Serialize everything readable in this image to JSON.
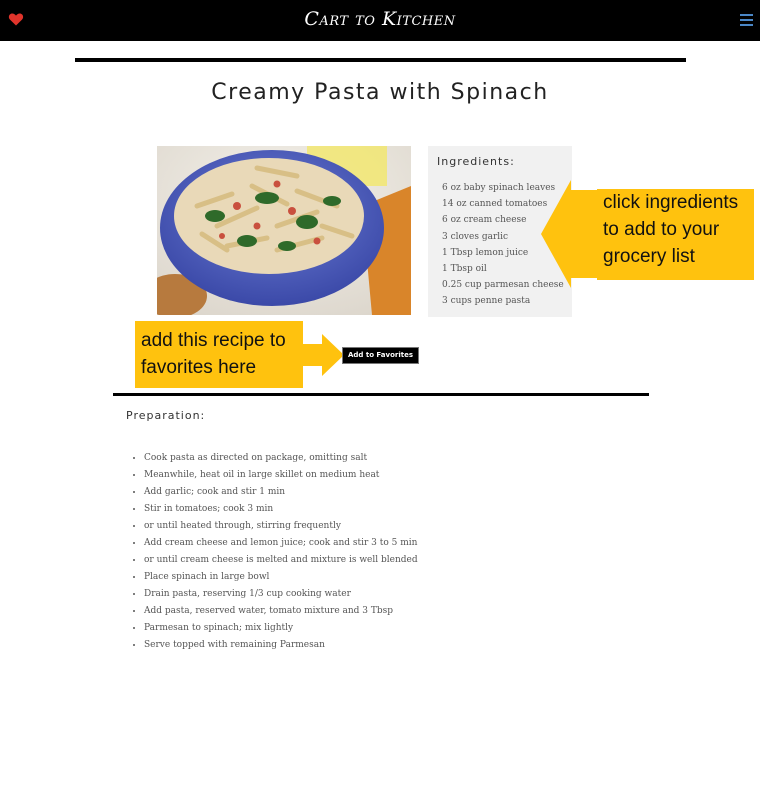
{
  "nav": {
    "brand": "Cart to Kitchen",
    "favorites_icon": "heart-icon",
    "menu_icon": "hamburger-menu-icon",
    "heart_color": "#e0342b",
    "menu_color": "#4a86c5"
  },
  "recipe": {
    "title": "Creamy Pasta with Spinach",
    "image": "pasta-bowl-photo"
  },
  "ingredients": {
    "heading": "Ingredients:",
    "items": [
      "6 oz baby spinach leaves",
      "14 oz canned tomatoes",
      "6 oz cream cheese",
      "3 cloves garlic",
      "1 Tbsp lemon juice",
      "1 Tbsp oil",
      "0.25 cup parmesan cheese",
      "3 cups penne pasta"
    ]
  },
  "callouts": {
    "ingredients_tip": "click ingredients to add to your grocery list",
    "favorites_tip": "add this recipe to favorites here",
    "color": "#ffc20e"
  },
  "favorites_button": {
    "label": "Add to Favorites"
  },
  "preparation": {
    "heading": "Preparation:",
    "steps": [
      "Cook pasta as directed on package, omitting salt",
      "Meanwhile, heat oil in large skillet on medium heat",
      "Add garlic; cook and stir 1 min",
      "Stir in tomatoes; cook 3 min",
      "or until heated through, stirring frequently",
      "Add cream cheese and lemon juice; cook and stir 3 to 5 min",
      "or until cream cheese is melted and mixture is well blended",
      "Place spinach in large bowl",
      "Drain pasta, reserving 1/3 cup cooking water",
      "Add pasta, reserved water, tomato mixture and 3 Tbsp",
      "Parmesan to spinach; mix lightly",
      "Serve topped with remaining Parmesan"
    ]
  }
}
